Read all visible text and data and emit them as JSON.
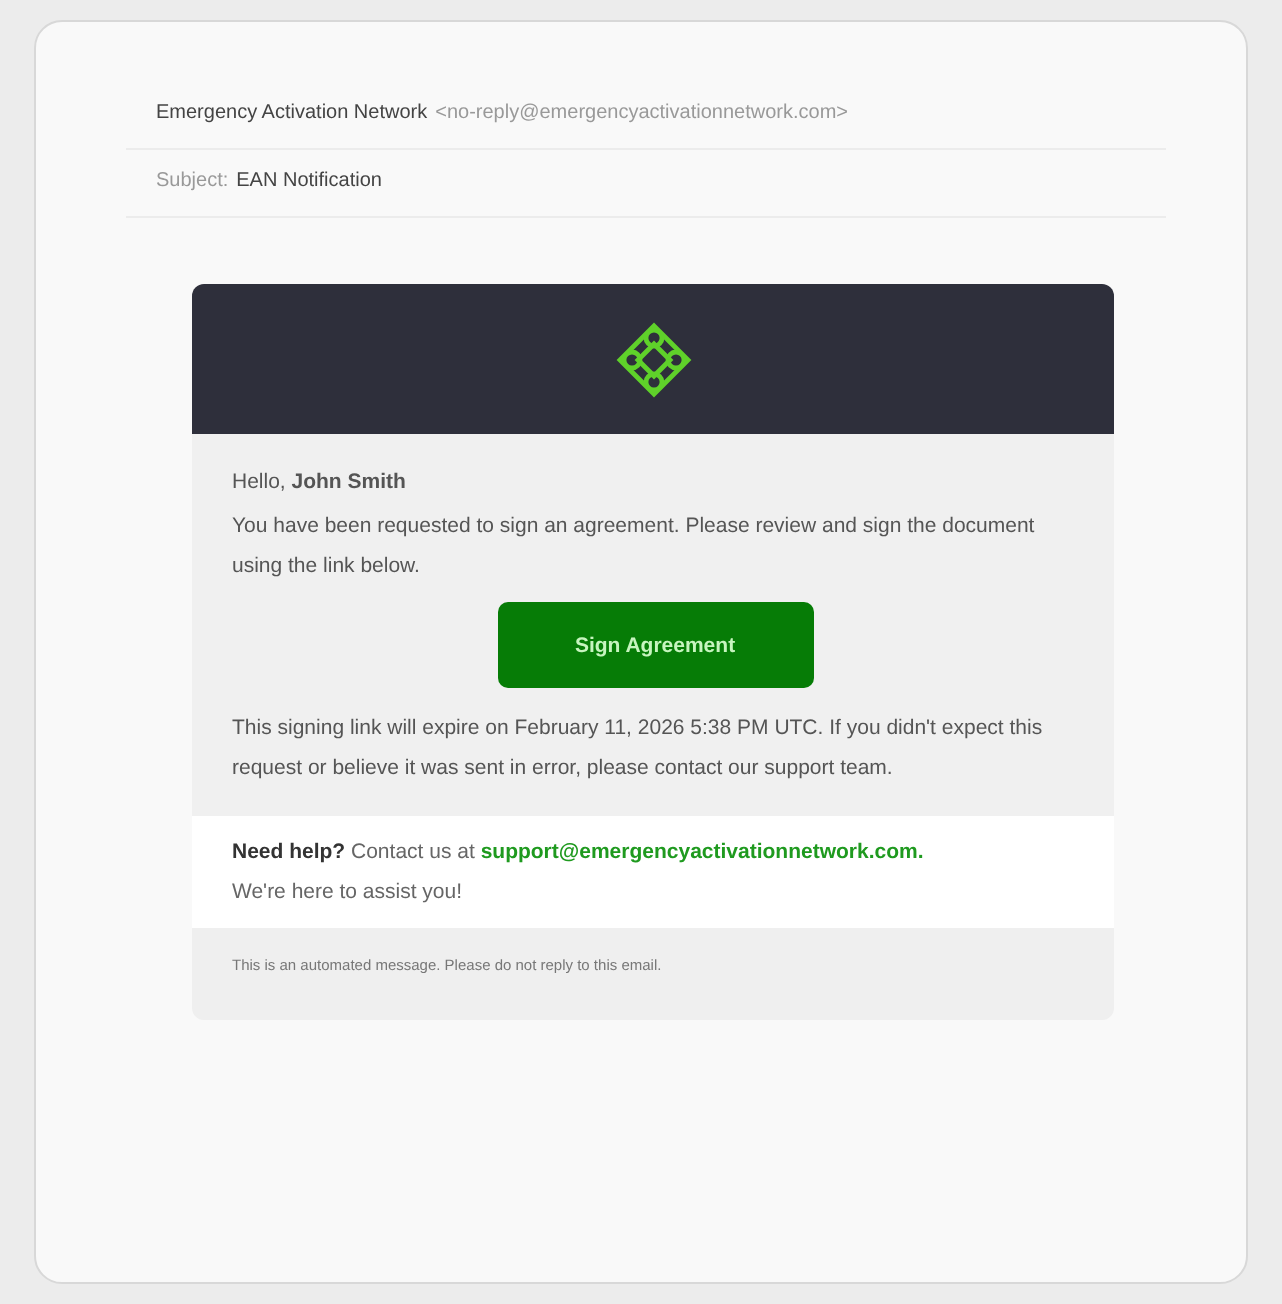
{
  "header": {
    "sender_name": "Emergency Activation Network",
    "sender_address": "<no-reply@emergencyactivationnetwork.com>",
    "subject_label": "Subject:",
    "subject": "EAN Notification"
  },
  "email": {
    "greeting": "Hello, **John Smith**",
    "intro": "You have been requested to sign an agreement. Please review and sign the document using the link below.",
    "button": "Sign Agreement",
    "expiry": "This signing link will expire on February 11, 2026 5:38 PM UTC. If you didn't expect this request or believe it was sent in error, please contact our support team.",
    "help": {
      "text": "**Need help?** Contact us at",
      "link": "support@emergencyactivationnetwork.com.",
      "after": "We're here to assist you!"
    },
    "footer": "This is an automated message. Please do not reply to this email."
  }
}
